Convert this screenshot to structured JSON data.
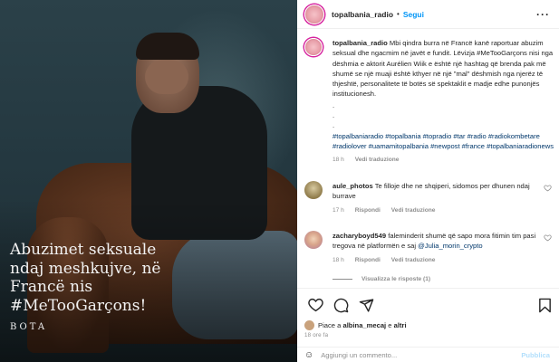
{
  "post": {
    "caption_line1": "Abuzimet seksuale",
    "caption_line2": "ndaj meshkujve, në",
    "caption_line3": "Francë nis",
    "caption_line4": "#MeTooGarçons!",
    "brand": "BOTA"
  },
  "header": {
    "username": "topalbania_radio",
    "separator": "•",
    "follow_label": "Segui",
    "more_label": "···"
  },
  "caption_comment": {
    "username": "topalbania_radio",
    "text": "Mbi qindra burra në Francë kanë raportuar abuzim seksual dhe ngacmim në javët e fundit. Lëvizja #MeTooGarçons nisi nga dëshmia e aktorit Aurélien Wiik e është një hashtag që brenda pak më shumë se një muaji është kthyer në një \"mal\" dëshmish nga njerëz të thjeshtë, personalitete të botës së spektaklit e madje edhe punonjës institucionesh.",
    "dots": [
      ".",
      ".",
      "."
    ],
    "hashtags": "#topalbaniaradio #topalbania #topradio #tar #radio #radiokombetare #radiolover #uamamitopalbania #newpost #france #topalbaniaradionews",
    "time": "18 h",
    "translate": "Vedi traduzione"
  },
  "comments": [
    {
      "username": "aule_photos",
      "text": "Te filloje dhe ne shqiperi, sidomos per dhunen ndaj burrave",
      "time": "17 h",
      "reply": "Rispondi",
      "translate": "Vedi traduzione"
    },
    {
      "username": "zacharyboyd549",
      "text": "faleminderit shumë që sapo mora fitimin tim pasi tregova në platformën e saj ",
      "mention": "@Julia_morin_crypto",
      "time": "18 h",
      "reply": "Rispondi",
      "translate": "Vedi traduzione",
      "view_replies": "Visualizza le risposte (1)"
    }
  ],
  "footer": {
    "likes_prefix": "Piace a ",
    "likes_user": "albina_mecaj",
    "likes_mid": " e ",
    "likes_others": "altri",
    "timestamp": "18 ore fa",
    "comment_placeholder": "Aggiungi un commento...",
    "post_label": "Pubblica"
  },
  "colors": {
    "link": "#0095f6",
    "hashtag": "#00376b",
    "muted": "#8e8e8e",
    "text": "#262626"
  }
}
